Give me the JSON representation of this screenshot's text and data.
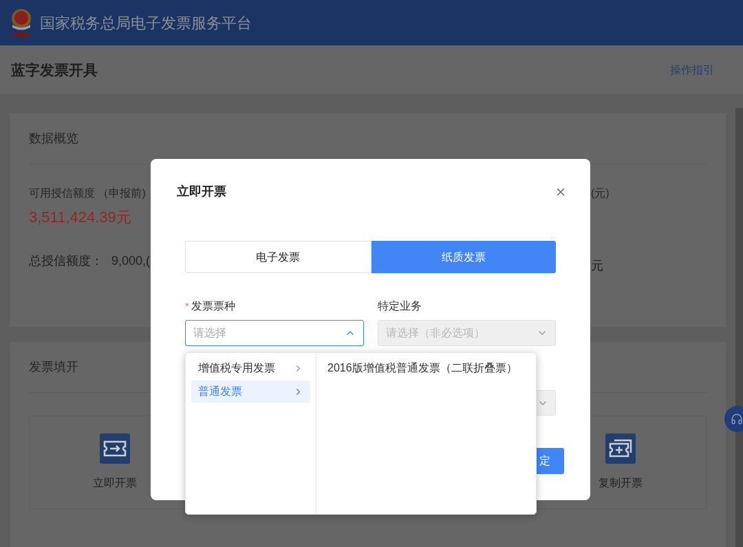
{
  "header": {
    "title": "国家税务总局电子发票服务平台"
  },
  "page": {
    "title": "蓝字发票开具",
    "guide_link": "操作指引"
  },
  "overview": {
    "title": "数据概览",
    "available_label": "可用授信额度 （申报前)",
    "available_value": "3,511,424.39元",
    "total_label": "总授信额度：",
    "total_value": "9,000,(",
    "right_label": "(元)",
    "right_value": "元"
  },
  "issue": {
    "title": "发票填开",
    "tiles": [
      {
        "label": "立即开票",
        "kind": "arrow"
      },
      {
        "label": "复制开票",
        "kind": "copy"
      }
    ]
  },
  "dialog": {
    "title": "立即开票",
    "segments": [
      {
        "label": "电子发票",
        "selected": false
      },
      {
        "label": "纸质发票",
        "selected": true
      }
    ],
    "fields": [
      {
        "label": "发票票种",
        "required_mark": "*",
        "placeholder": "请选择",
        "disabled": false,
        "expanded": true
      },
      {
        "label": "特定业务",
        "placeholder": "请选择（非必选项）",
        "disabled": true,
        "expanded": false
      }
    ],
    "confirm_button": "定"
  },
  "cascader": {
    "options": [
      {
        "label": "增值税专用发票",
        "selected": false
      },
      {
        "label": "普通发票",
        "selected": true
      }
    ],
    "sub_options": [
      "2016版增值税普通发票（二联折叠票）"
    ]
  }
}
